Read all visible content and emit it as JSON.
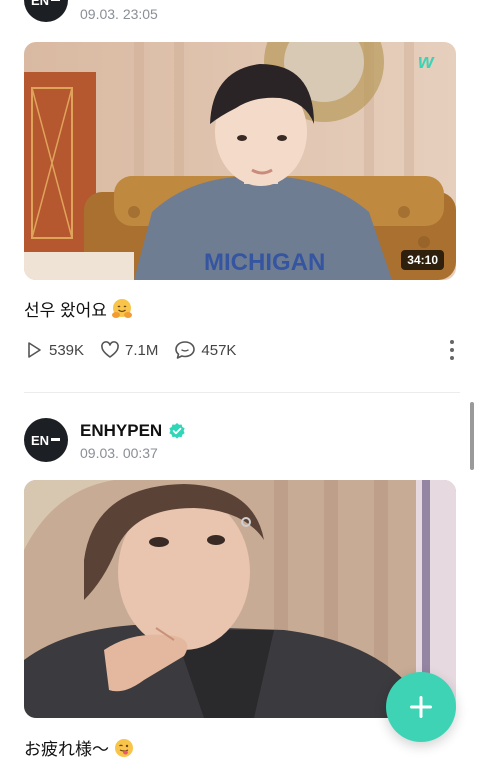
{
  "feed": {
    "posts": [
      {
        "author": "",
        "date": "09.03. 23:05",
        "duration": "34:10",
        "caption": "선우 왔어요",
        "caption_emoji": "hugging-face-emoji",
        "stats": {
          "plays": "539K",
          "likes": "7.1M",
          "comments": "457K"
        }
      },
      {
        "author": "ENHYPEN",
        "verified": true,
        "date": "09.03. 00:37",
        "caption": "お疲れ様～",
        "caption_emoji": "face-with-tongue-emoji"
      }
    ]
  },
  "brand": {
    "accent": "#3fd3b6",
    "verified": "#2fd6b8",
    "avatar_bg": "#1c1f24",
    "logo": "EN-"
  },
  "icons": {
    "fab": "plus-icon",
    "more": "more-vertical-icon",
    "watermark": "weverse-w-icon"
  }
}
